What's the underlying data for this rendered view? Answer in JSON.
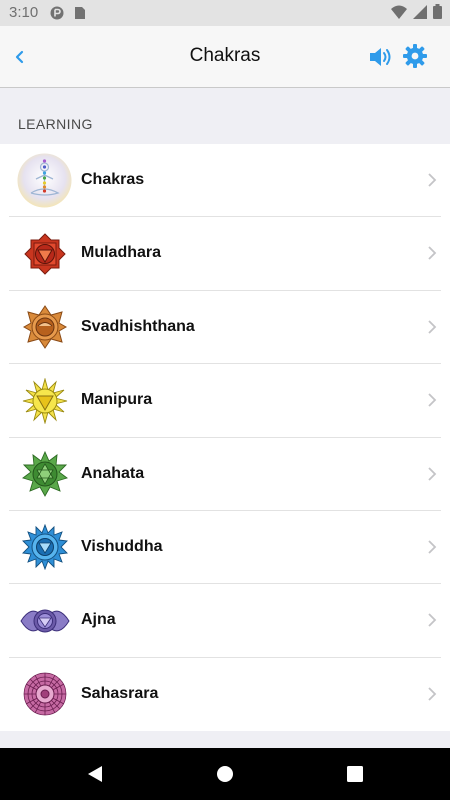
{
  "status_bar": {
    "time": "3:10"
  },
  "nav": {
    "title": "Chakras"
  },
  "section": {
    "header": "LEARNING"
  },
  "items": [
    {
      "label": "Chakras",
      "icon": "meditation-figure-icon",
      "color": "#c9a7e0"
    },
    {
      "label": "Muladhara",
      "icon": "muladhara-chakra-icon",
      "color": "#c9361f"
    },
    {
      "label": "Svadhishthana",
      "icon": "svadhishthana-chakra-icon",
      "color": "#d2772b"
    },
    {
      "label": "Manipura",
      "icon": "manipura-chakra-icon",
      "color": "#f1dc2a"
    },
    {
      "label": "Anahata",
      "icon": "anahata-chakra-icon",
      "color": "#4e9a3a"
    },
    {
      "label": "Vishuddha",
      "icon": "vishuddha-chakra-icon",
      "color": "#2f8fd6"
    },
    {
      "label": "Ajna",
      "icon": "ajna-chakra-icon",
      "color": "#6b5aa8"
    },
    {
      "label": "Sahasrara",
      "icon": "sahasrara-chakra-icon",
      "color": "#a13f7b"
    }
  ],
  "colors": {
    "accent": "#2f9bea"
  }
}
